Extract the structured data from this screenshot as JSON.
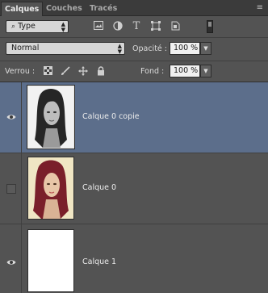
{
  "tabs": [
    {
      "label": "Calques",
      "active": true
    },
    {
      "label": "Couches",
      "active": false
    },
    {
      "label": "Tracés",
      "active": false
    }
  ],
  "filter": {
    "kind_label": "Type",
    "icons": [
      "image-filter-icon",
      "adjustment-filter-icon",
      "type-filter-icon",
      "shape-filter-icon",
      "smart-object-filter-icon",
      "filter-toggle-icon"
    ]
  },
  "blend": {
    "mode": "Normal",
    "opacity_label": "Opacité :",
    "opacity_value": "100 %"
  },
  "lock": {
    "label": "Verrou :",
    "icons": [
      "lock-transparent-pixels-icon",
      "lock-image-pixels-icon",
      "lock-position-icon",
      "lock-all-icon"
    ],
    "fill_label": "Fond :",
    "fill_value": "100 %"
  },
  "layers": [
    {
      "name": "Calque 0 copie",
      "visible": true,
      "selected": true,
      "thumb": "bw-portrait"
    },
    {
      "name": "Calque 0",
      "visible": false,
      "selected": false,
      "thumb": "color-portrait"
    },
    {
      "name": "Calque 1",
      "visible": true,
      "selected": false,
      "thumb": "white"
    }
  ],
  "colors": {
    "panel_bg": "#535353",
    "selected_row": "#5c6e8b"
  }
}
